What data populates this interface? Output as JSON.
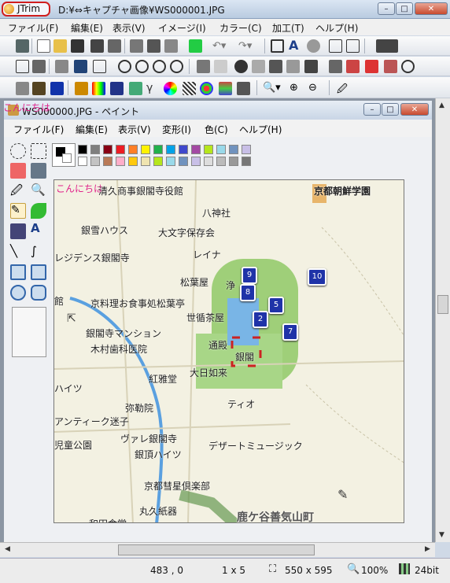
{
  "app": {
    "name": "JTrim",
    "title": "D:¥⇔キャプチャ画像¥WS000001.JPG"
  },
  "menu": [
    "ファイル(F)",
    "編集(E)",
    "表示(V)",
    "イメージ(I)",
    "カラー(C)",
    "加工(T)",
    "ヘルプ(H)"
  ],
  "paint": {
    "title": "WS000000.JPG - ペイント",
    "menu": [
      "ファイル(F)",
      "編集(E)",
      "表示(V)",
      "変形(I)",
      "色(C)",
      "ヘルプ(H)"
    ]
  },
  "overlay_labels": [
    "こんにちは",
    "こんにちは"
  ],
  "map": {
    "labels": [
      "清久商事銀閣寺役館",
      "京都朝鮮学園",
      "八神社",
      "銀雪ハウス",
      "大文字保存会",
      "レジデンス銀閣寺",
      "レイナ",
      "松葉屋",
      "浄",
      "館",
      "京料理お食事処松葉亭",
      "世循茶屋",
      "銀閣寺マンション",
      "木村歯科医院",
      "通殿",
      "銀閣",
      "大日如来",
      "紅雅堂",
      "ハイツ",
      "ティオ",
      "弥勒院",
      "アンティーク迷子",
      "ヴァレ銀閣寺",
      "児童公園",
      "デザートミュージック",
      "銀頂ハイツ",
      "京都彗星倶楽部",
      "丸久紙器",
      "和田食堂",
      "鹿ケ谷善気山町"
    ],
    "pins": [
      "9",
      "8",
      "5",
      "2",
      "7",
      "10"
    ]
  },
  "status": {
    "coords": "483 , 0",
    "selection": "1 x 5",
    "size": "550 x 595",
    "zoom": "100%",
    "depth": "24bit"
  },
  "colors": {
    "accent_red": "#d01e1e",
    "pin_blue": "#1f33a8",
    "park_green": "#9fcf79",
    "map_bg": "#f3f1e2"
  }
}
